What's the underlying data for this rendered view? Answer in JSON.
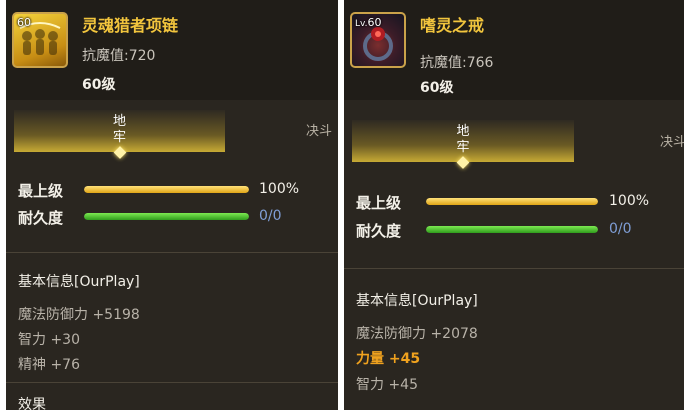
{
  "left": {
    "level_badge": "60",
    "name": "灵魂猎者项链",
    "resist": "抗魔值:720",
    "level_text": "60级",
    "tab_active": "地牢",
    "tab_inactive": "决斗",
    "stats": [
      {
        "label": "最上级",
        "value": "100%",
        "fill": 1.0
      },
      {
        "label": "耐久度",
        "value": "0/0",
        "fill": 1.0
      }
    ],
    "section_title": "基本信息[OurPlay]",
    "attributes": [
      "魔法防御力 +5198",
      "智力 +30",
      "精神 +76"
    ],
    "effects_title": "效果"
  },
  "right": {
    "level_prefix": "Lv.",
    "level_badge": "60",
    "name": "嗜灵之戒",
    "resist": "抗魔值:766",
    "level_text": "60级",
    "tab_active": "地牢",
    "tab_inactive": "决斗",
    "stats": [
      {
        "label": "最上级",
        "value": "100%",
        "fill": 1.0
      },
      {
        "label": "耐久度",
        "value": "0/0",
        "fill": 1.0
      }
    ],
    "section_title": "基本信息[OurPlay]",
    "attributes": [
      "魔法防御力 +2078",
      "力量 +45",
      "智力 +45"
    ]
  },
  "colors": {
    "name_gold": "#f2c53d",
    "durability_value": "#7f9ed6",
    "highlight_attr": "#f0a21e"
  },
  "icons": {
    "left_item": "necklace-icon",
    "right_item": "ring-icon"
  }
}
